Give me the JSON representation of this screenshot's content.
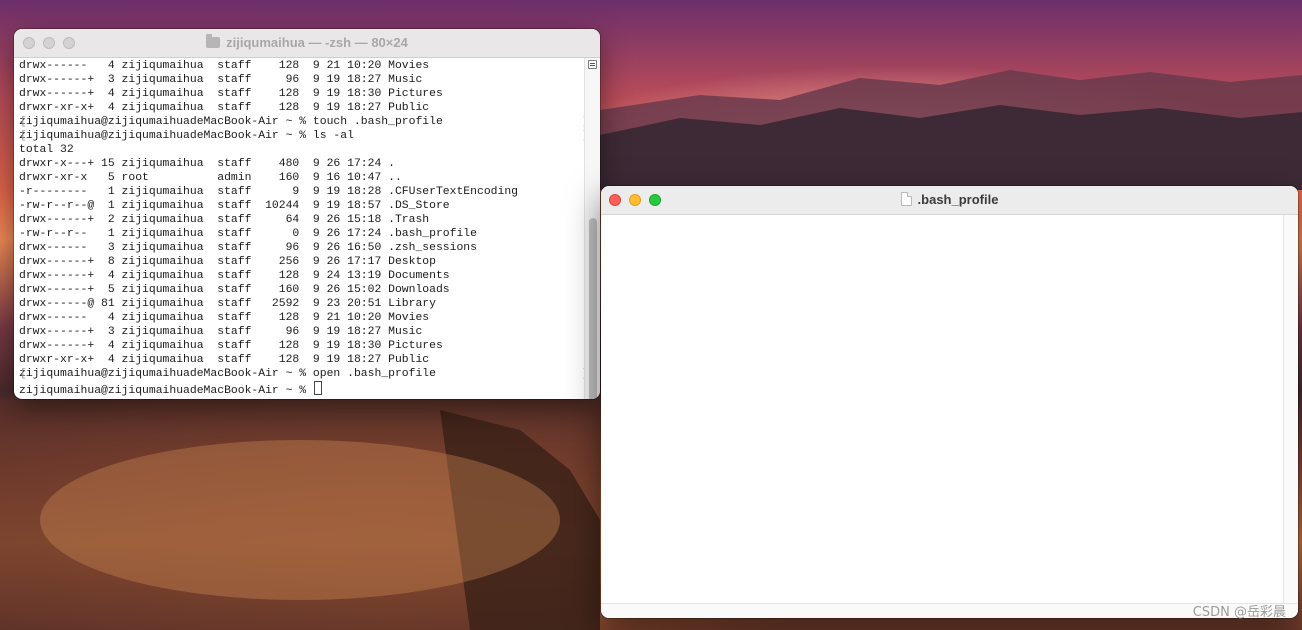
{
  "terminal": {
    "title": "zijiqumaihua — -zsh — 80×24",
    "lines": [
      {
        "text": "drwx------   4 zijiqumaihua  staff    128  9 21 10:20 Movies",
        "marked": false
      },
      {
        "text": "drwx------+  3 zijiqumaihua  staff     96  9 19 18:27 Music",
        "marked": false
      },
      {
        "text": "drwx------+  4 zijiqumaihua  staff    128  9 19 18:30 Pictures",
        "marked": false
      },
      {
        "text": "drwxr-xr-x+  4 zijiqumaihua  staff    128  9 19 18:27 Public",
        "marked": false
      },
      {
        "text": "zijiqumaihua@zijiqumaihuadeMacBook-Air ~ % touch .bash_profile",
        "marked": true
      },
      {
        "text": "zijiqumaihua@zijiqumaihuadeMacBook-Air ~ % ls -al",
        "marked": true
      },
      {
        "text": "total 32",
        "marked": false
      },
      {
        "text": "drwxr-x---+ 15 zijiqumaihua  staff    480  9 26 17:24 .",
        "marked": false
      },
      {
        "text": "drwxr-xr-x   5 root          admin    160  9 16 10:47 ..",
        "marked": false
      },
      {
        "text": "-r--------   1 zijiqumaihua  staff      9  9 19 18:28 .CFUserTextEncoding",
        "marked": false
      },
      {
        "text": "-rw-r--r--@  1 zijiqumaihua  staff  10244  9 19 18:57 .DS_Store",
        "marked": false
      },
      {
        "text": "drwx------+  2 zijiqumaihua  staff     64  9 26 15:18 .Trash",
        "marked": false
      },
      {
        "text": "-rw-r--r--   1 zijiqumaihua  staff      0  9 26 17:24 .bash_profile",
        "marked": false
      },
      {
        "text": "drwx------   3 zijiqumaihua  staff     96  9 26 16:50 .zsh_sessions",
        "marked": false
      },
      {
        "text": "drwx------+  8 zijiqumaihua  staff    256  9 26 17:17 Desktop",
        "marked": false
      },
      {
        "text": "drwx------+  4 zijiqumaihua  staff    128  9 24 13:19 Documents",
        "marked": false
      },
      {
        "text": "drwx------+  5 zijiqumaihua  staff    160  9 26 15:02 Downloads",
        "marked": false
      },
      {
        "text": "drwx------@ 81 zijiqumaihua  staff   2592  9 23 20:51 Library",
        "marked": false
      },
      {
        "text": "drwx------   4 zijiqumaihua  staff    128  9 21 10:20 Movies",
        "marked": false
      },
      {
        "text": "drwx------+  3 zijiqumaihua  staff     96  9 19 18:27 Music",
        "marked": false
      },
      {
        "text": "drwx------+  4 zijiqumaihua  staff    128  9 19 18:30 Pictures",
        "marked": false
      },
      {
        "text": "drwxr-xr-x+  4 zijiqumaihua  staff    128  9 19 18:27 Public",
        "marked": false
      },
      {
        "text": "zijiqumaihua@zijiqumaihuadeMacBook-Air ~ % open .bash_profile",
        "marked": true
      }
    ],
    "prompt": "zijiqumaihua@zijiqumaihuadeMacBook-Air ~ % "
  },
  "editor": {
    "title": ".bash_profile",
    "content": ""
  },
  "watermark": "CSDN @岳彩晨",
  "icons": {
    "terminal_title": "folder-icon",
    "editor_title": "document-icon"
  }
}
